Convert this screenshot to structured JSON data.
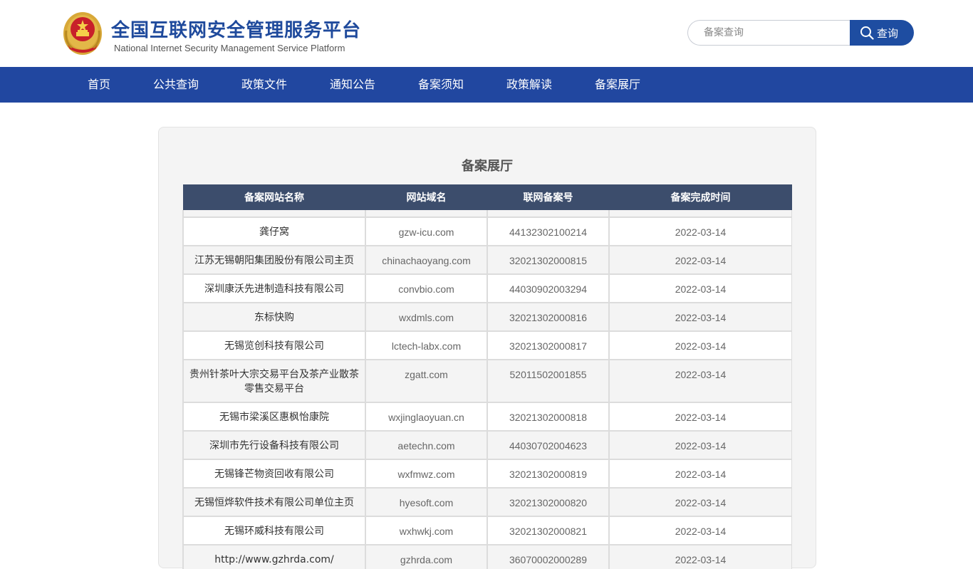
{
  "header": {
    "title": "全国互联网安全管理服务平台",
    "subtitle": "National Internet Security Management Service Platform",
    "search_placeholder": "备案查询",
    "search_button": "查询"
  },
  "nav": [
    "首页",
    "公共查询",
    "政策文件",
    "通知公告",
    "备案须知",
    "政策解读",
    "备案展厅"
  ],
  "panel": {
    "title": "备案展厅",
    "columns": [
      "备案网站名称",
      "网站域名",
      "联网备案号",
      "备案完成时间"
    ],
    "rows": [
      {
        "name": "龚仔窝",
        "domain": "gzw-icu.com",
        "number": "44132302100214",
        "date": "2022-03-14"
      },
      {
        "name": "江苏无锡朝阳集团股份有限公司主页",
        "domain": "chinachaoyang.com",
        "number": "32021302000815",
        "date": "2022-03-14"
      },
      {
        "name": "深圳康沃先进制造科技有限公司",
        "domain": "convbio.com",
        "number": "44030902003294",
        "date": "2022-03-14"
      },
      {
        "name": "东标快购",
        "domain": "wxdmls.com",
        "number": "32021302000816",
        "date": "2022-03-14"
      },
      {
        "name": "无锡览创科技有限公司",
        "domain": "lctech-labx.com",
        "number": "32021302000817",
        "date": "2022-03-14"
      },
      {
        "name": "贵州针茶叶大宗交易平台及茶产业散茶零售交易平台",
        "domain": "zgatt.com",
        "number": "52011502001855",
        "date": "2022-03-14"
      },
      {
        "name": "无锡市梁溪区惠枫怡康院",
        "domain": "wxjinglaoyuan.cn",
        "number": "32021302000818",
        "date": "2022-03-14"
      },
      {
        "name": "深圳市先行设备科技有限公司",
        "domain": "aetechn.com",
        "number": "44030702004623",
        "date": "2022-03-14"
      },
      {
        "name": "无锡锋芒物资回收有限公司",
        "domain": "wxfmwz.com",
        "number": "32021302000819",
        "date": "2022-03-14"
      },
      {
        "name": "无锡恒烨软件技术有限公司单位主页",
        "domain": "hyesoft.com",
        "number": "32021302000820",
        "date": "2022-03-14"
      },
      {
        "name": "无锡环威科技有限公司",
        "domain": "wxhwkj.com",
        "number": "32021302000821",
        "date": "2022-03-14"
      },
      {
        "name": "http://www.gzhrda.com/",
        "domain": "gzhrda.com",
        "number": "36070002000289",
        "date": "2022-03-14"
      }
    ]
  },
  "colors": {
    "brand_blue": "#1f4a9c",
    "nav_bg": "#2147a0",
    "table_header_bg": "#3c4d6c"
  }
}
